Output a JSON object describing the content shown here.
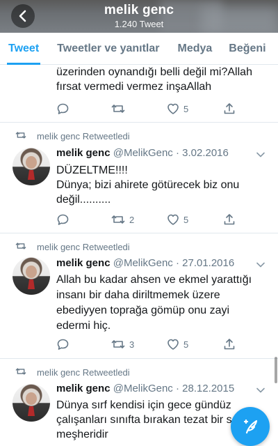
{
  "header": {
    "title": "melik genc",
    "subtitle": "1.240 Tweet"
  },
  "tabs": [
    {
      "label": "Tweet",
      "active": true
    },
    {
      "label": "Tweetler ve yanıtlar",
      "active": false
    },
    {
      "label": "Medya",
      "active": false
    },
    {
      "label": "Beğeni",
      "active": false
    }
  ],
  "tweets": [
    {
      "text": "üzerinden oynandığı belli değil mi?Allah\nfırsat vermedi vermez inşaAllah",
      "replies": "",
      "retweets": "",
      "likes": "5"
    },
    {
      "retweet_label": "melik genc Retweetledi",
      "name": "melik genc",
      "handle": "@MelikGenc · 3.02.2016",
      "text": "DÜZELTME!!!!\nDünya; bizi ahirete götürecek biz onu\ndeğil..........",
      "replies": "",
      "retweets": "2",
      "likes": "5"
    },
    {
      "retweet_label": "melik genc Retweetledi",
      "name": "melik genc",
      "handle": "@MelikGenc · 27.01.2016",
      "text": "Allah bu kadar ahsen ve ekmel yarattığı\ninsanı bir daha diriltmemek üzere\nebediyyen toprağa gömüp onu zayi\nedermi hiç.",
      "replies": "",
      "retweets": "3",
      "likes": "5"
    },
    {
      "retweet_label": "melik genc Retweetledi",
      "name": "melik genc",
      "handle": "@MelikGenc · 28.12.2015",
      "text": "Dünya sırf kendisi için gece gündüz\nçalışanları sınıfta bırakan tezat bir s\nmeşheridir"
    }
  ],
  "colors": {
    "accent": "#1da1f2",
    "secondary_text": "#657786",
    "divider": "#e1e8ed"
  },
  "icons": {
    "back": "back-arrow-icon",
    "reply": "reply-icon",
    "retweet": "retweet-icon",
    "like": "heart-icon",
    "share": "share-icon",
    "compose": "compose-icon"
  }
}
